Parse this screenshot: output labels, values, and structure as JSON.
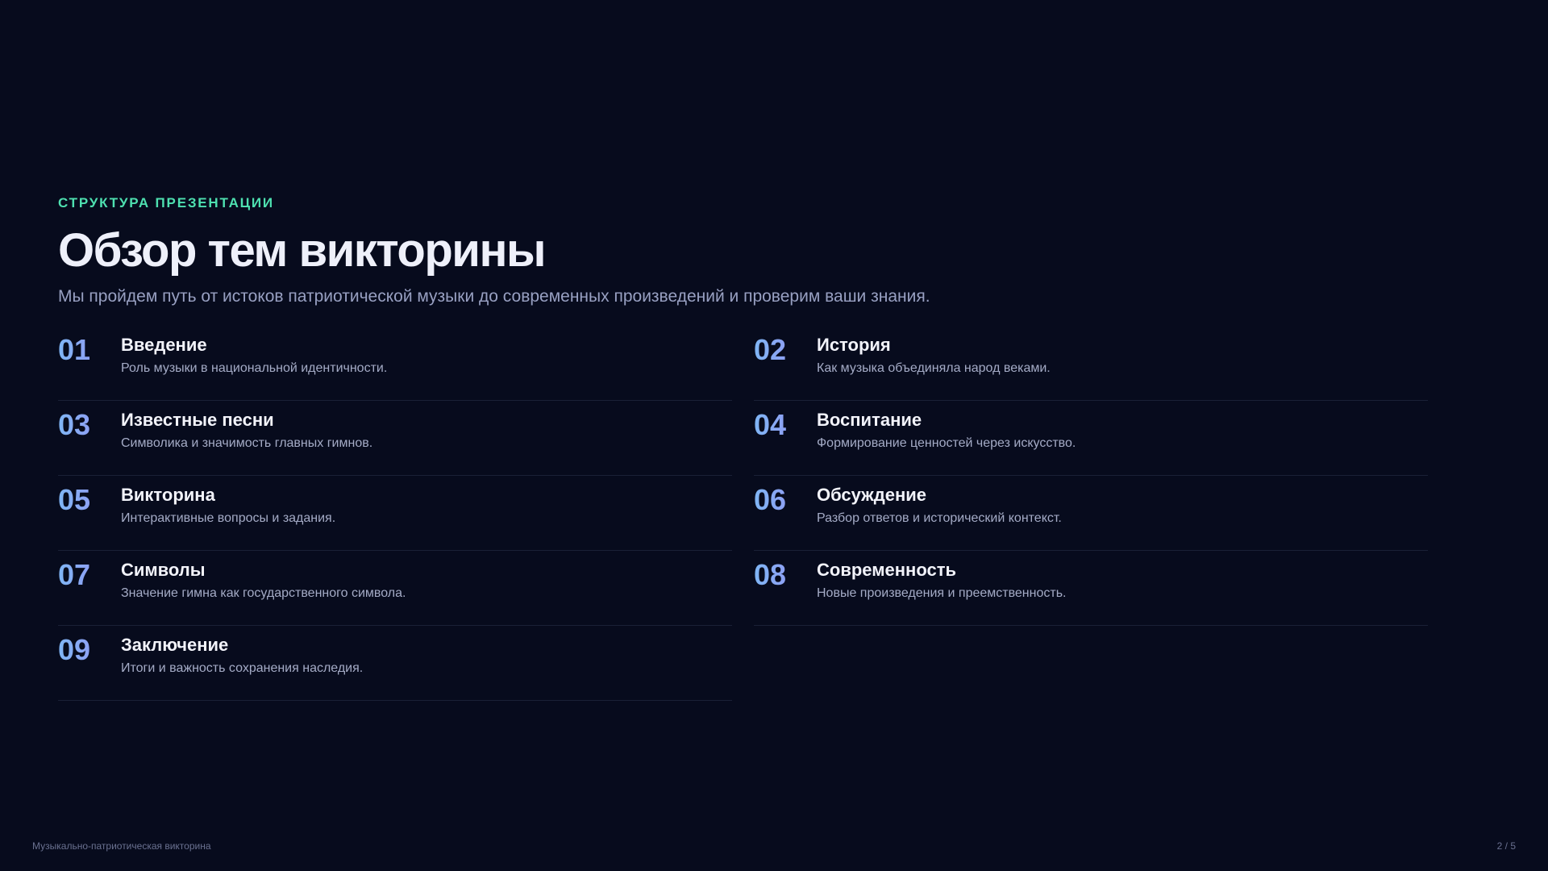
{
  "header": {
    "eyebrow": "СТРУКТУРА ПРЕЗЕНТАЦИИ",
    "title": "Обзор тем викторины",
    "subtitle": "Мы пройдем путь от истоков патриотической музыки до современных произведений и проверим ваши знания."
  },
  "topics": [
    {
      "num": "01",
      "title": "Введение",
      "desc": "Роль музыки в национальной идентичности."
    },
    {
      "num": "02",
      "title": "История",
      "desc": "Как музыка объединяла народ веками."
    },
    {
      "num": "03",
      "title": "Известные песни",
      "desc": "Символика и значимость главных гимнов."
    },
    {
      "num": "04",
      "title": "Воспитание",
      "desc": "Формирование ценностей через искусство."
    },
    {
      "num": "05",
      "title": "Викторина",
      "desc": "Интерактивные вопросы и задания."
    },
    {
      "num": "06",
      "title": "Обсуждение",
      "desc": "Разбор ответов и исторический контекст."
    },
    {
      "num": "07",
      "title": "Символы",
      "desc": "Значение гимна как государственного символа."
    },
    {
      "num": "08",
      "title": "Современность",
      "desc": "Новые произведения и преемственность."
    },
    {
      "num": "09",
      "title": "Заключение",
      "desc": "Итоги и важность сохранения наследия."
    }
  ],
  "footer": {
    "left": "Музыкально-патриотическая викторина",
    "right": "2 / 5"
  },
  "colors": {
    "background": "#070b1d",
    "accent": "#4ee0b0",
    "number_gradient_start": "#7fb6f5",
    "number_gradient_end": "#9a8df2"
  }
}
